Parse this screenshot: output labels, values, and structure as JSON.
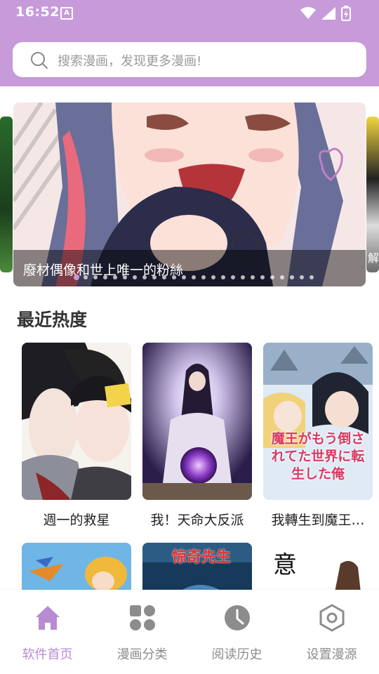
{
  "status_bar": {
    "time": "16:52",
    "notification_badge": "A"
  },
  "search": {
    "placeholder": "搜索漫画，发现更多漫画!"
  },
  "banner": {
    "title": "廢材偶像和世上唯一的粉絲",
    "next_title_partial": "解",
    "dot_count": 25,
    "active_dot": 0
  },
  "recent": {
    "title": "最近热度",
    "items": [
      {
        "name": "週一的救星"
      },
      {
        "name": "我！天命大反派"
      },
      {
        "name": "我轉生到魔王…"
      }
    ],
    "cover3_text": "魔王がもう倒されてた世界に転生した俺",
    "row2_cover2_text": "惊奇先生",
    "row2_cover3_text": "意"
  },
  "bottom_nav": [
    {
      "label": "软件首页",
      "icon": "home-icon",
      "active": true
    },
    {
      "label": "漫画分类",
      "icon": "grid-icon",
      "active": false
    },
    {
      "label": "阅读历史",
      "icon": "clock-icon",
      "active": false
    },
    {
      "label": "设置漫源",
      "icon": "settings-icon",
      "active": false
    }
  ],
  "colors": {
    "accent": "#c79bd9",
    "active_nav": "#b98bd2",
    "inactive_nav": "#8c8c8c"
  }
}
